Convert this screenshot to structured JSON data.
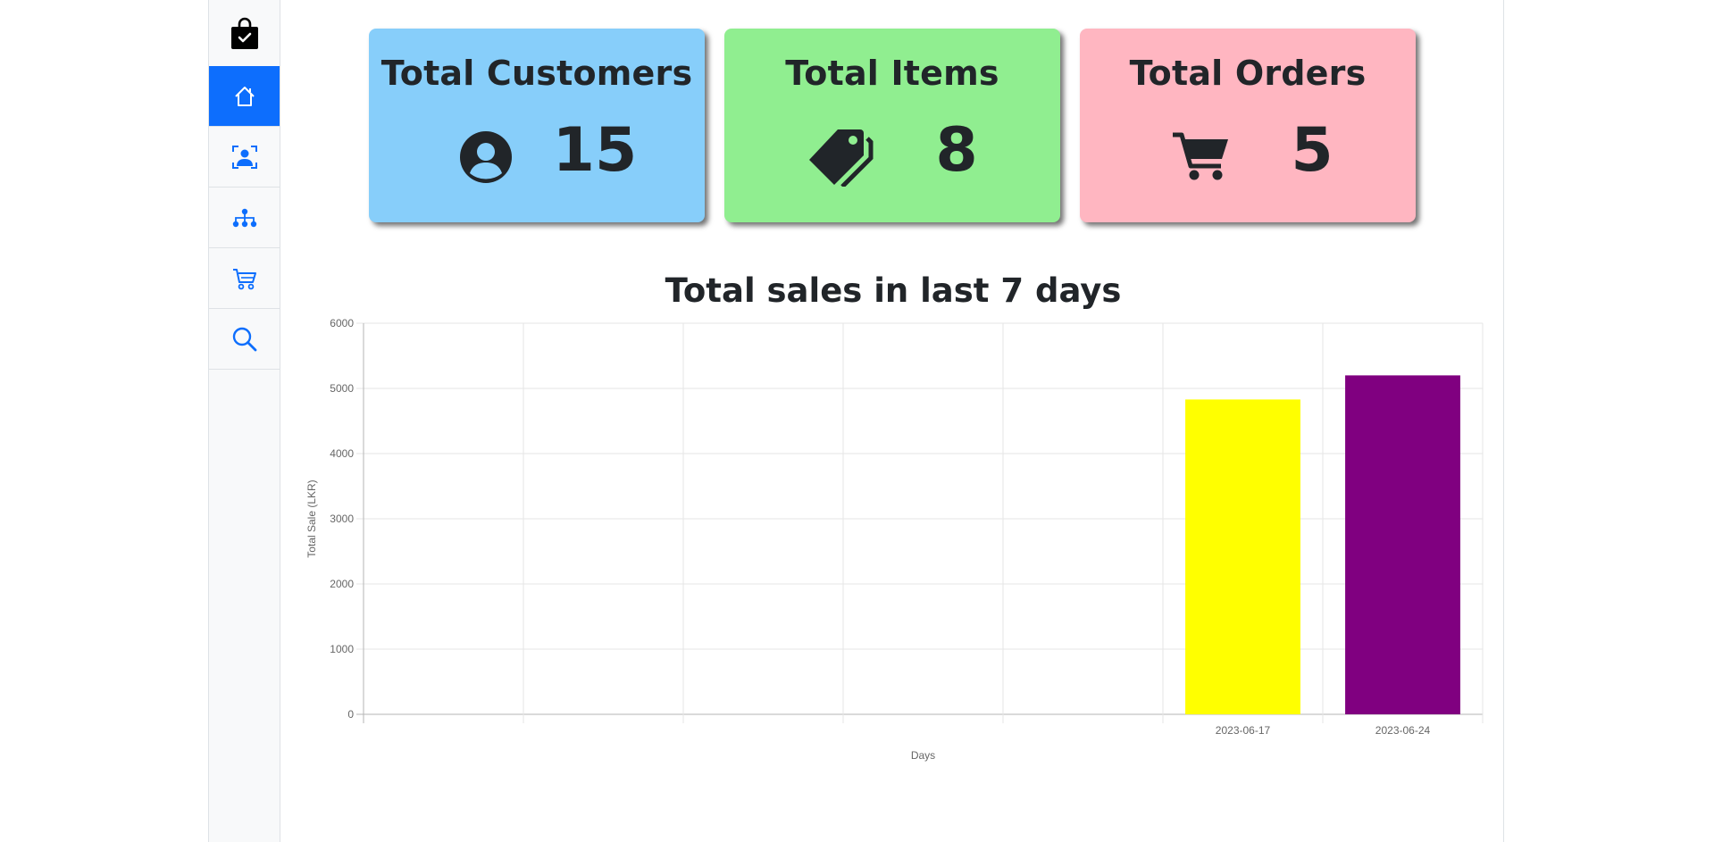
{
  "sidebar": {
    "items": [
      {
        "name": "shopping-bag-icon",
        "active": false
      },
      {
        "name": "home-icon",
        "active": true
      },
      {
        "name": "customer-icon",
        "active": false
      },
      {
        "name": "sitemap-icon",
        "active": false
      },
      {
        "name": "cart-icon",
        "active": false
      },
      {
        "name": "search-icon",
        "active": false
      }
    ],
    "accent": "#0d6efd",
    "icon_color": "#0d6efd"
  },
  "cards": {
    "customers": {
      "title": "Total Customers",
      "count": "15",
      "icon": "user-circle-icon",
      "color": "#87cefa"
    },
    "items": {
      "title": "Total Items",
      "count": "8",
      "icon": "tags-icon",
      "color": "#90ee90"
    },
    "orders": {
      "title": "Total Orders",
      "count": "5",
      "icon": "shopping-cart-icon",
      "color": "#ffb6c1"
    }
  },
  "chart_data": {
    "type": "bar",
    "title": "Total sales in last 7 days",
    "xlabel": "Days",
    "ylabel": "Total Sale (LKR)",
    "categories": [
      "",
      "",
      "",
      "",
      "",
      "2023-06-17",
      "2023-06-24"
    ],
    "values": [
      null,
      null,
      null,
      null,
      null,
      4830,
      5200
    ],
    "colors": [
      "",
      "",
      "",
      "",
      "",
      "#ffff00",
      "#800080"
    ],
    "ylim": [
      0,
      6000
    ],
    "yticks": [
      "0",
      "1000",
      "2000",
      "3000",
      "4000",
      "5000",
      "6000"
    ],
    "grid": true,
    "legend": "none"
  }
}
